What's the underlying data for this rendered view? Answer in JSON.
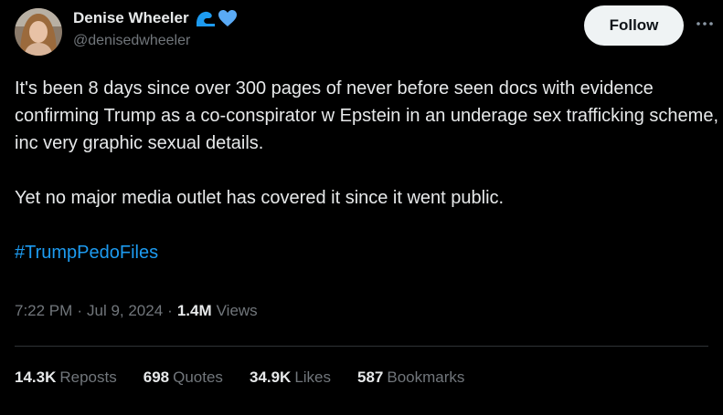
{
  "author": {
    "display_name": "Denise Wheeler",
    "handle": "@denisedwheeler",
    "badge_icons": [
      "wave-emoji-icon",
      "blue-heart-emoji-icon"
    ]
  },
  "follow_label": "Follow",
  "more_label": "···",
  "tweet": {
    "paragraph1": "It's been 8 days since over 300 pages of never before seen docs with evidence confirming Trump as a co-conspirator w Epstein in an underage sex trafficking scheme, inc very graphic sexual details.",
    "paragraph2": "Yet no major media outlet has covered it since it went public.",
    "hashtag": "#TrumpPedoFiles"
  },
  "meta": {
    "time": "7:22 PM",
    "separator": "·",
    "date": "Jul 9, 2024",
    "views_count": "1.4M",
    "views_label": "Views"
  },
  "stats": {
    "reposts_count": "14.3K",
    "reposts_label": "Reposts",
    "quotes_count": "698",
    "quotes_label": "Quotes",
    "likes_count": "34.9K",
    "likes_label": "Likes",
    "bookmarks_count": "587",
    "bookmarks_label": "Bookmarks"
  },
  "colors": {
    "background": "#000000",
    "text": "#e7e9ea",
    "secondary_text": "#71767b",
    "hashtag": "#1d9bf0",
    "follow_button_bg": "#eff3f4"
  }
}
